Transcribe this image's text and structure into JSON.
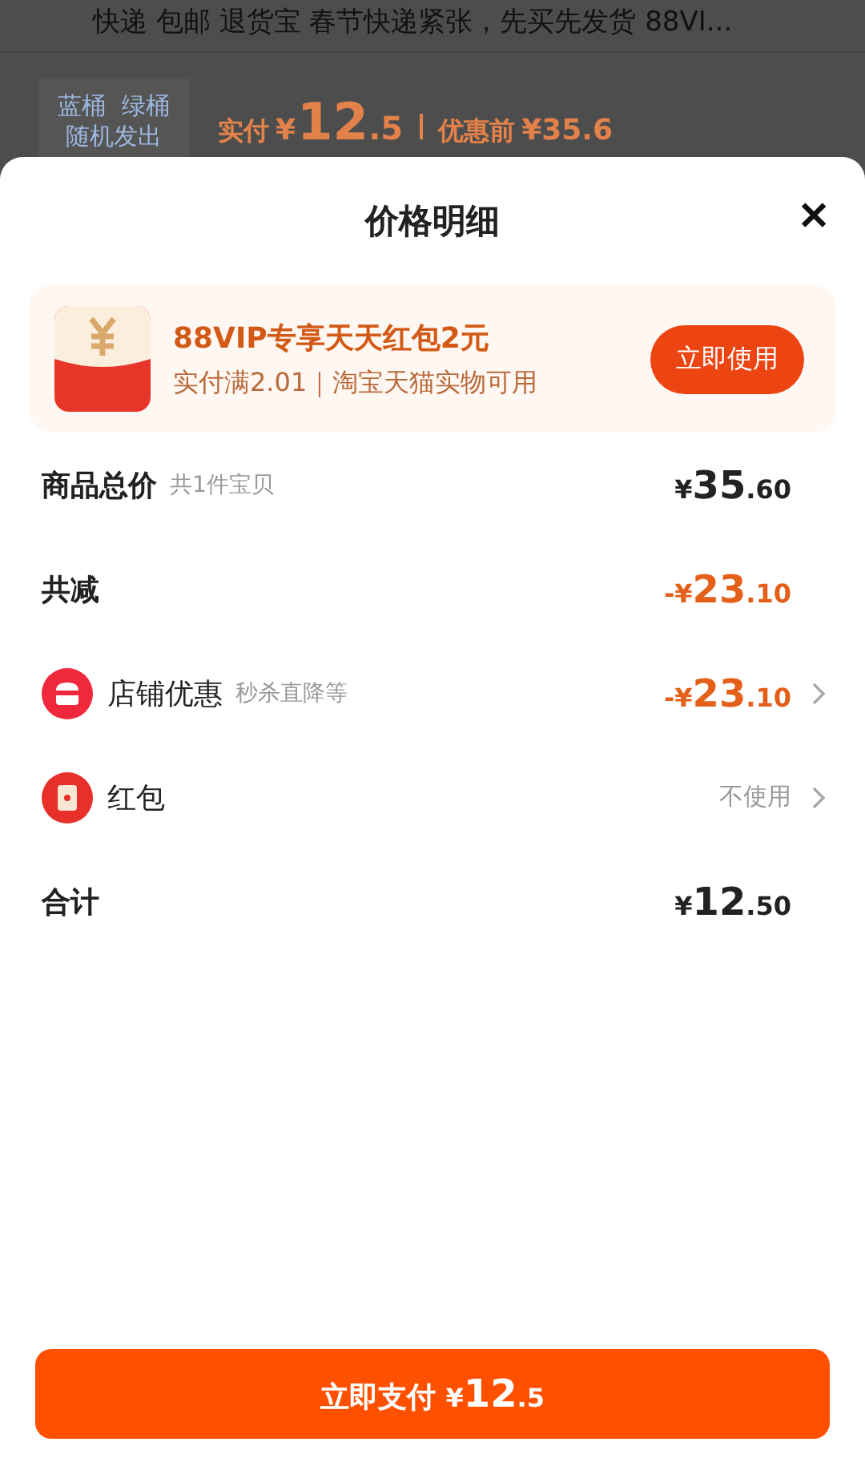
{
  "background": {
    "title": "快递 包邮 退货宝 春节快递紧张，先买先发货 88VI...",
    "thumbnail_lines": [
      "蓝桶  绿桶",
      "随机发出"
    ],
    "paid_label": "实付",
    "paid_currency": "¥",
    "paid_major": "12",
    "paid_minor": ".5",
    "before_label": "优惠前",
    "before_price": "¥35.6"
  },
  "sheet": {
    "title": "价格明细",
    "close": "✕",
    "promo": {
      "title": "88VIP专享天天红包2元",
      "subtitle": "实付满2.01｜淘宝天猫实物可用",
      "button": "立即使用"
    },
    "rows": [
      {
        "kind": "plain",
        "label": "商品总价",
        "note": "共1件宝贝",
        "prefix": "¥",
        "major": "35",
        "minor": ".60",
        "accent": false
      },
      {
        "kind": "plain",
        "label": "共减",
        "prefix": "-¥",
        "major": "23",
        "minor": ".10",
        "accent": true
      },
      {
        "kind": "shop",
        "label": "店铺优惠",
        "note": "秒杀直降等",
        "prefix": "-¥",
        "major": "23",
        "minor": ".10",
        "accent": true,
        "chevron": true
      },
      {
        "kind": "packet",
        "label": "红包",
        "value": "不使用",
        "chevron": true
      },
      {
        "kind": "plain",
        "label": "合计",
        "prefix": "¥",
        "major": "12",
        "minor": ".50",
        "accent": false
      }
    ],
    "pay_button": {
      "label": "立即支付",
      "prefix": "¥",
      "major": "12",
      "minor": ".5"
    }
  }
}
